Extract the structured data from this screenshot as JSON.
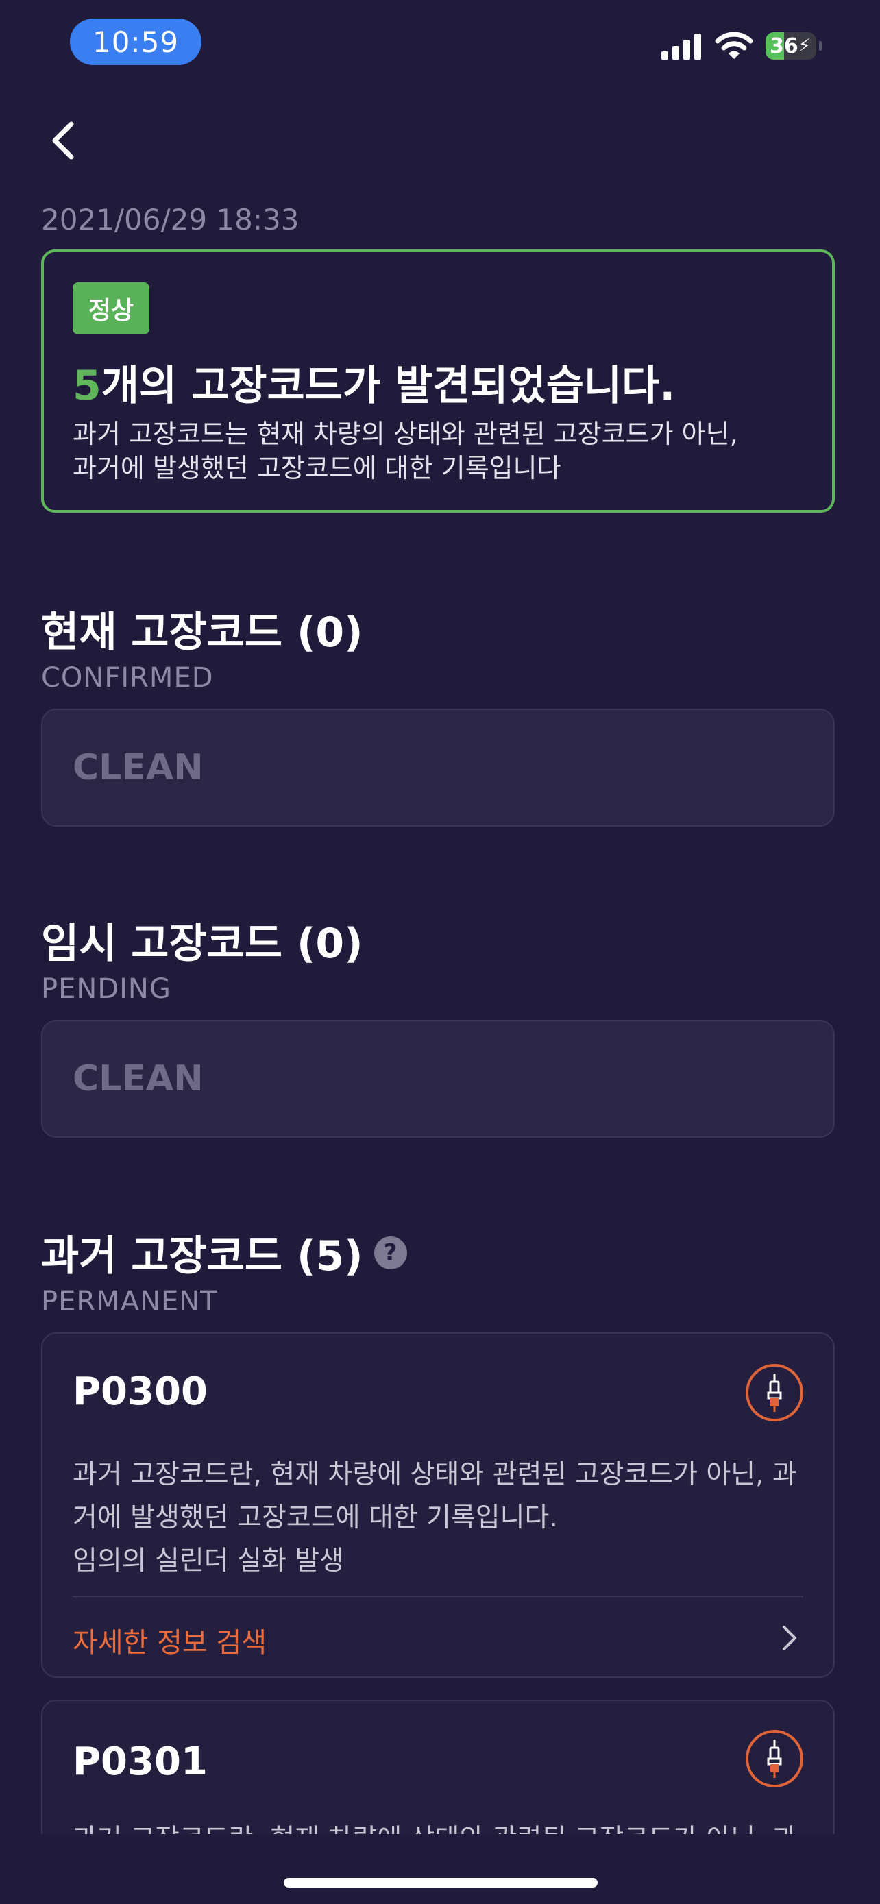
{
  "status_bar": {
    "time": "10:59",
    "battery_level": "36",
    "battery_fraction": 0.36
  },
  "colors": {
    "background": "#201b3a",
    "normal_green": "#5fb65b",
    "accent_orange": "#ea6b3c",
    "time_pill_blue": "#3a7ff2"
  },
  "header": {
    "back_icon": "chevron-left-icon"
  },
  "report": {
    "date": "2021/06/29 18:33",
    "status_badge": "정상",
    "code_count": "5",
    "title_suffix": "개의 고장코드가 발견되었습니다.",
    "description_line1": "과거 고장코드는 현재 차량의 상태와 관련된 고장코드가 아닌,",
    "description_line2": "과거에 발생했던 고장코드에 대한 기록입니다"
  },
  "sections": {
    "current": {
      "title": "현재 고장코드 (0)",
      "subtitle": "CONFIRMED",
      "empty_text": "CLEAN"
    },
    "pending": {
      "title": "임시 고장코드 (0)",
      "subtitle": "PENDING",
      "empty_text": "CLEAN"
    },
    "permanent": {
      "title": "과거 고장코드 (5)",
      "subtitle": "PERMANENT",
      "help_icon": "question-icon",
      "help_label": "?"
    }
  },
  "codes": [
    {
      "code": "P0300",
      "icon": "spark-plug-icon",
      "description_line1": "과거 고장코드란, 현재 차량에 상태와 관련된 고장코드가 아닌, 과",
      "description_line2": "거에 발생했던 고장코드에 대한 기록입니다.",
      "description_line3": "임의의 실린더 실화 발생",
      "link": "자세한 정보 검색"
    },
    {
      "code": "P0301",
      "icon": "spark-plug-icon",
      "description_line1": "과거 고장코드란, 현재 차량에 상태와 관련된 고장코드가 아닌, 과"
    }
  ]
}
